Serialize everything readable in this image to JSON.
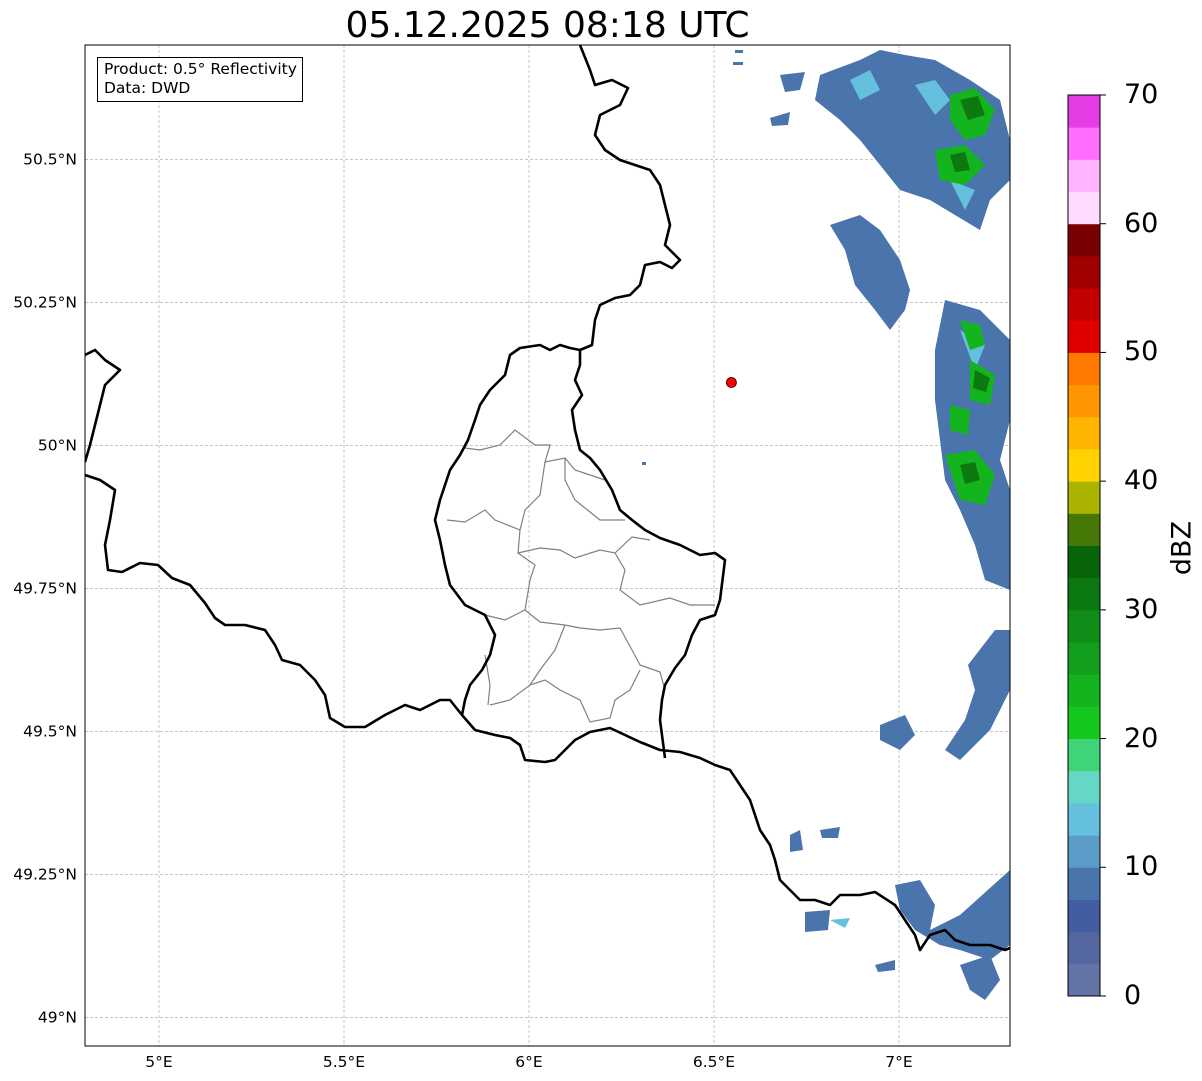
{
  "title": "05.12.2025 08:18 UTC",
  "info_box": {
    "product": "Product: 0.5° Reflectivity",
    "source": "Data: DWD"
  },
  "map": {
    "lon_range": [
      4.8,
      7.3
    ],
    "lat_range": [
      48.95,
      50.7
    ],
    "lon_ticks": [
      {
        "value": 5.0,
        "label": "5°E"
      },
      {
        "value": 5.5,
        "label": "5.5°E"
      },
      {
        "value": 6.0,
        "label": "6°E"
      },
      {
        "value": 6.5,
        "label": "6.5°E"
      },
      {
        "value": 7.0,
        "label": "7°E"
      }
    ],
    "lat_ticks": [
      {
        "value": 49.0,
        "label": "49°N"
      },
      {
        "value": 49.25,
        "label": "49.25°N"
      },
      {
        "value": 49.5,
        "label": "49.5°N"
      },
      {
        "value": 49.75,
        "label": "49.75°N"
      },
      {
        "value": 50.0,
        "label": "50°N"
      },
      {
        "value": 50.25,
        "label": "50.25°N"
      },
      {
        "value": 50.5,
        "label": "50.5°N"
      }
    ],
    "gridlines": true,
    "radar_site": {
      "lon": 6.547,
      "lat": 50.11,
      "color": "#ff0000"
    },
    "border_color": "#000000",
    "region_border_color": "#808080"
  },
  "colorbar": {
    "label": "dBZ",
    "min": 0,
    "max": 70,
    "ticks": [
      "0",
      "10",
      "20",
      "30",
      "40",
      "50",
      "60",
      "70"
    ],
    "colors": [
      "#6574a6",
      "#5467a1",
      "#435da2",
      "#4a74ac",
      "#5a9bc8",
      "#64c0dc",
      "#64d8c4",
      "#40d478",
      "#14c81e",
      "#14b41e",
      "#12a01c",
      "#108c18",
      "#0c7810",
      "#086408",
      "#467808",
      "#aab400",
      "#ffd200",
      "#ffb400",
      "#ff9600",
      "#ff7800",
      "#e10000",
      "#c30000",
      "#a00000",
      "#780000",
      "#ffdcff",
      "#ffb4ff",
      "#ff6eff",
      "#e63ce6"
    ]
  }
}
